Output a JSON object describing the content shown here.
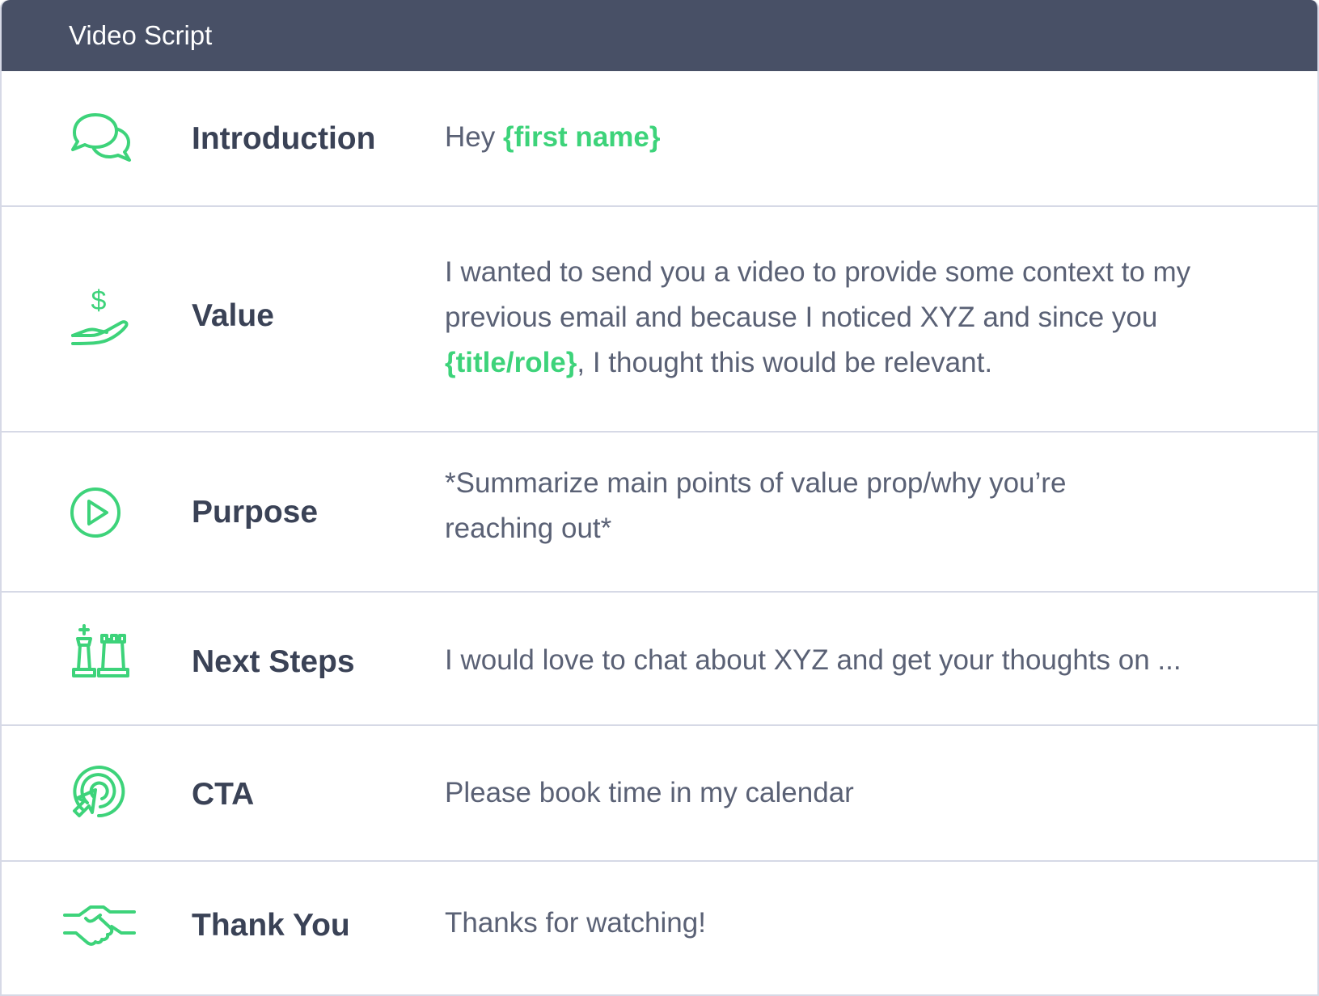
{
  "header": {
    "title": "Video Script"
  },
  "colors": {
    "header_bg": "#485066",
    "accent_green": "#3dd37a",
    "label": "#3a4256",
    "body_text": "#5a6175",
    "divider": "#d6d9e6"
  },
  "rows": [
    {
      "icon": "speech-bubbles-icon",
      "label": "Introduction",
      "text_1": "Hey ",
      "var_1": "{first name}"
    },
    {
      "icon": "hand-dollar-icon",
      "label": "Value",
      "text_1": "I wanted to send you a video to provide some context to my previous email and because I noticed XYZ and since you ",
      "var_1": "{title/role}",
      "text_2": ", I thought this would be relevant."
    },
    {
      "icon": "play-circle-icon",
      "label": "Purpose",
      "text_1": "*Summarize main points of value prop/why you’re reaching out*"
    },
    {
      "icon": "chess-pieces-icon",
      "label": "Next Steps",
      "text_1": "I would love to chat about XYZ and get your thoughts on ..."
    },
    {
      "icon": "target-cursor-icon",
      "label": "CTA",
      "text_1": "Please book time in my calendar"
    },
    {
      "icon": "handshake-icon",
      "label": "Thank You",
      "text_1": "Thanks for watching!"
    }
  ]
}
